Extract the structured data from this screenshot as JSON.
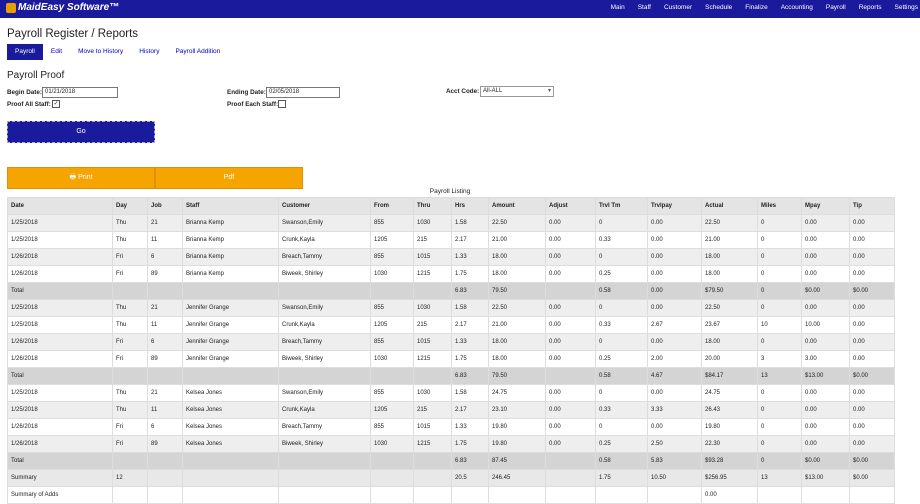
{
  "app": {
    "logo": "MaidEasy Software™"
  },
  "nav": [
    "Main",
    "Staff",
    "Customer",
    "Schedule",
    "Finalize",
    "Accounting",
    "Payroll",
    "Reports",
    "Settings"
  ],
  "page_title": "Payroll Register / Reports",
  "tabs": [
    "Payroll",
    "Edit",
    "Move to History",
    "History",
    "Payroll Addition"
  ],
  "section_title": "Payroll Proof",
  "form": {
    "begin_label": "Begin Date:",
    "begin_value": "01/21/2018",
    "end_label": "Ending Date:",
    "end_value": "02/05/2018",
    "acct_label": "Acct Code:",
    "acct_value": "All-ALL",
    "proof_all_label": "Proof All Staff:",
    "proof_all_checked": true,
    "proof_each_label": "Proof Each Staff:",
    "proof_each_checked": false,
    "go_label": "Go"
  },
  "buttons": {
    "print": "Print",
    "pdf": "Pdf"
  },
  "table": {
    "caption": "Payroll Listing",
    "headers": [
      "Date",
      "Day",
      "Job",
      "Staff",
      "Customer",
      "From",
      "Thru",
      "Hrs",
      "Amount",
      "Adjust",
      "Trvl Tm",
      "Trvlpay",
      "Actual",
      "Miles",
      "Mpay",
      "Tip"
    ],
    "rows": [
      {
        "type": "alt",
        "cells": [
          "1/25/2018",
          "Thu",
          "21",
          "Brianna Kemp",
          "Swanson,Emily",
          "855",
          "1030",
          "1.58",
          "22.50",
          "0.00",
          "0",
          "0.00",
          "22.50",
          "0",
          "0.00",
          "0.00"
        ]
      },
      {
        "type": "row",
        "cells": [
          "1/25/2018",
          "Thu",
          "11",
          "Brianna Kemp",
          "Crunk,Kayla",
          "1205",
          "215",
          "2.17",
          "21.00",
          "0.00",
          "0.33",
          "0.00",
          "21.00",
          "0",
          "0.00",
          "0.00"
        ]
      },
      {
        "type": "alt",
        "cells": [
          "1/26/2018",
          "Fri",
          "6",
          "Brianna Kemp",
          "Breach,Tammy",
          "855",
          "1015",
          "1.33",
          "18.00",
          "0.00",
          "0",
          "0.00",
          "18.00",
          "0",
          "0.00",
          "0.00"
        ]
      },
      {
        "type": "row",
        "cells": [
          "1/26/2018",
          "Fri",
          "89",
          "Brianna Kemp",
          "Biweek, Shirley",
          "1030",
          "1215",
          "1.75",
          "18.00",
          "0.00",
          "0.25",
          "0.00",
          "18.00",
          "0",
          "0.00",
          "0.00"
        ]
      },
      {
        "type": "total",
        "cells": [
          "Total",
          "",
          "",
          "",
          "",
          "",
          "",
          "6.83",
          "79.50",
          "",
          "0.58",
          "0.00",
          "$79.50",
          "0",
          "$0.00",
          "$0.00"
        ]
      },
      {
        "type": "alt",
        "cells": [
          "1/25/2018",
          "Thu",
          "21",
          "Jennifer Grange",
          "Swanson,Emily",
          "855",
          "1030",
          "1.58",
          "22.50",
          "0.00",
          "0",
          "0.00",
          "22.50",
          "0",
          "0.00",
          "0.00"
        ]
      },
      {
        "type": "row",
        "cells": [
          "1/25/2018",
          "Thu",
          "11",
          "Jennifer Grange",
          "Crunk,Kayla",
          "1205",
          "215",
          "2.17",
          "21.00",
          "0.00",
          "0.33",
          "2.67",
          "23.67",
          "10",
          "10.00",
          "0.00"
        ]
      },
      {
        "type": "alt",
        "cells": [
          "1/26/2018",
          "Fri",
          "6",
          "Jennifer Grange",
          "Breach,Tammy",
          "855",
          "1015",
          "1.33",
          "18.00",
          "0.00",
          "0",
          "0.00",
          "18.00",
          "0",
          "0.00",
          "0.00"
        ]
      },
      {
        "type": "row",
        "cells": [
          "1/26/2018",
          "Fri",
          "89",
          "Jennifer Grange",
          "Biweek, Shirley",
          "1030",
          "1215",
          "1.75",
          "18.00",
          "0.00",
          "0.25",
          "2.00",
          "20.00",
          "3",
          "3.00",
          "0.00"
        ]
      },
      {
        "type": "total",
        "cells": [
          "Total",
          "",
          "",
          "",
          "",
          "",
          "",
          "6.83",
          "79.50",
          "",
          "0.58",
          "4.67",
          "$84.17",
          "13",
          "$13.00",
          "$0.00"
        ]
      },
      {
        "type": "row",
        "cells": [
          "1/25/2018",
          "Thu",
          "21",
          "Kelsea Jones",
          "Swanson,Emily",
          "855",
          "1030",
          "1.58",
          "24.75",
          "0.00",
          "0",
          "0.00",
          "24.75",
          "0",
          "0.00",
          "0.00"
        ]
      },
      {
        "type": "alt",
        "cells": [
          "1/25/2018",
          "Thu",
          "11",
          "Kelsea Jones",
          "Crunk,Kayla",
          "1205",
          "215",
          "2.17",
          "23.10",
          "0.00",
          "0.33",
          "3.33",
          "26.43",
          "0",
          "0.00",
          "0.00"
        ]
      },
      {
        "type": "row",
        "cells": [
          "1/26/2018",
          "Fri",
          "6",
          "Kelsea Jones",
          "Breach,Tammy",
          "855",
          "1015",
          "1.33",
          "19.80",
          "0.00",
          "0",
          "0.00",
          "19.80",
          "0",
          "0.00",
          "0.00"
        ]
      },
      {
        "type": "alt",
        "cells": [
          "1/26/2018",
          "Fri",
          "89",
          "Kelsea Jones",
          "Biweek, Shirley",
          "1030",
          "1215",
          "1.75",
          "19.80",
          "0.00",
          "0.25",
          "2.50",
          "22.30",
          "0",
          "0.00",
          "0.00"
        ]
      },
      {
        "type": "total",
        "cells": [
          "Total",
          "",
          "",
          "",
          "",
          "",
          "",
          "6.83",
          "87.45",
          "",
          "0.58",
          "5.83",
          "$93.28",
          "0",
          "$0.00",
          "$0.00"
        ]
      },
      {
        "type": "summary",
        "cells": [
          "Summary",
          "12",
          "",
          "",
          "",
          "",
          "",
          "20.5",
          "246.45",
          "",
          "1.75",
          "10.50",
          "$256.95",
          "13",
          "$13.00",
          "$0.00"
        ]
      },
      {
        "type": "row",
        "cells": [
          "Summary of Adds",
          "",
          "",
          "",
          "",
          "",
          "",
          "",
          "",
          "",
          "",
          "",
          "0.00",
          "",
          "",
          ""
        ]
      }
    ]
  }
}
